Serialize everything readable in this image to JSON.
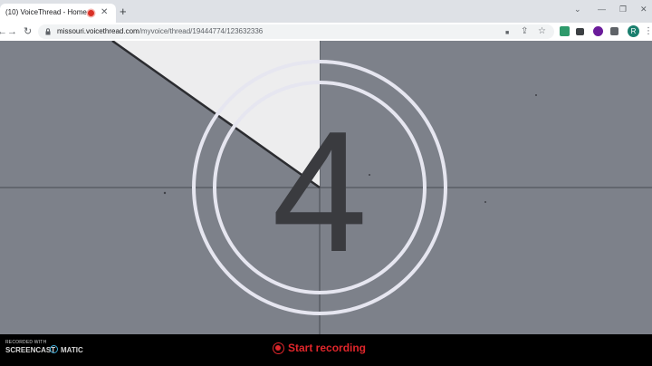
{
  "browser": {
    "tab": {
      "title": "(10) VoiceThread - Home",
      "close_glyph": "✕"
    },
    "new_tab_glyph": "+",
    "window_controls": {
      "collapse": "⌄",
      "minimize": "—",
      "restore": "❐",
      "close": "✕"
    },
    "nav": {
      "back": "←",
      "forward": "→",
      "reload": "↻"
    },
    "address": {
      "host": "missouri.voicethread.com",
      "path": "/myvoice/thread/19444774/123632336"
    },
    "omnibox_icons": {
      "camera": "■",
      "share": "⇪",
      "bookmark": "☆"
    },
    "profile_initial": "R",
    "menu_glyph": "⋮"
  },
  "countdown": {
    "number": "4",
    "colors": {
      "background": "#7d818a",
      "ring": "#e6e6f0",
      "digit": "#3a3b3f",
      "wedge": "#ededee"
    }
  },
  "recorder": {
    "watermark_line1": "RECORDED WITH",
    "watermark_brand_a": "SCREENCAST",
    "watermark_brand_b": "MATIC",
    "start_label": "Start recording",
    "accent_color": "#e0262b"
  }
}
